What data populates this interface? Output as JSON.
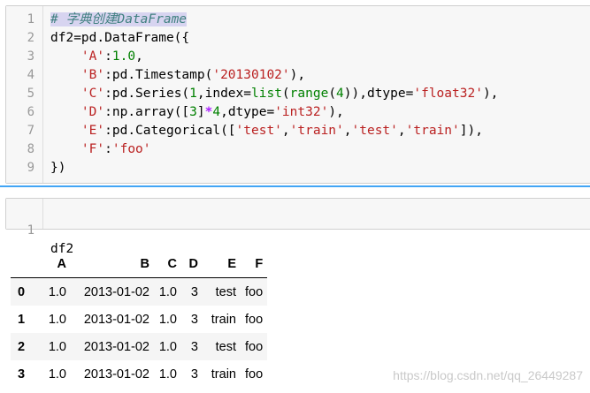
{
  "cell1": {
    "line_numbers": [
      "1",
      "2",
      "3",
      "4",
      "5",
      "6",
      "7",
      "8",
      "9"
    ],
    "lines": [
      [
        {
          "t": "# 字典创建DataFrame",
          "c": "cm"
        }
      ],
      [
        {
          "t": "df2=pd.DataFrame({",
          "c": ""
        }
      ],
      [
        {
          "t": "    ",
          "c": ""
        },
        {
          "t": "'A'",
          "c": "str"
        },
        {
          "t": ":",
          "c": ""
        },
        {
          "t": "1.0",
          "c": "num"
        },
        {
          "t": ",",
          "c": ""
        }
      ],
      [
        {
          "t": "    ",
          "c": ""
        },
        {
          "t": "'B'",
          "c": "str"
        },
        {
          "t": ":pd.Timestamp(",
          "c": ""
        },
        {
          "t": "'20130102'",
          "c": "str"
        },
        {
          "t": "),",
          "c": ""
        }
      ],
      [
        {
          "t": "    ",
          "c": ""
        },
        {
          "t": "'C'",
          "c": "str"
        },
        {
          "t": ":pd.Series(",
          "c": ""
        },
        {
          "t": "1",
          "c": "num"
        },
        {
          "t": ",index=",
          "c": ""
        },
        {
          "t": "list",
          "c": "kw"
        },
        {
          "t": "(",
          "c": ""
        },
        {
          "t": "range",
          "c": "kw"
        },
        {
          "t": "(",
          "c": ""
        },
        {
          "t": "4",
          "c": "num"
        },
        {
          "t": ")),dtype=",
          "c": ""
        },
        {
          "t": "'float32'",
          "c": "str"
        },
        {
          "t": "),",
          "c": ""
        }
      ],
      [
        {
          "t": "    ",
          "c": ""
        },
        {
          "t": "'D'",
          "c": "str"
        },
        {
          "t": ":np.array([",
          "c": ""
        },
        {
          "t": "3",
          "c": "num"
        },
        {
          "t": "]",
          "c": ""
        },
        {
          "t": "*",
          "c": "op"
        },
        {
          "t": "4",
          "c": "num"
        },
        {
          "t": ",dtype=",
          "c": ""
        },
        {
          "t": "'int32'",
          "c": "str"
        },
        {
          "t": "),",
          "c": ""
        }
      ],
      [
        {
          "t": "    ",
          "c": ""
        },
        {
          "t": "'E'",
          "c": "str"
        },
        {
          "t": ":pd.Categorical([",
          "c": ""
        },
        {
          "t": "'test'",
          "c": "str"
        },
        {
          "t": ",",
          "c": ""
        },
        {
          "t": "'train'",
          "c": "str"
        },
        {
          "t": ",",
          "c": ""
        },
        {
          "t": "'test'",
          "c": "str"
        },
        {
          "t": ",",
          "c": ""
        },
        {
          "t": "'train'",
          "c": "str"
        },
        {
          "t": "]),",
          "c": ""
        }
      ],
      [
        {
          "t": "    ",
          "c": ""
        },
        {
          "t": "'F'",
          "c": "str"
        },
        {
          "t": ":",
          "c": ""
        },
        {
          "t": "'foo'",
          "c": "str"
        }
      ],
      [
        {
          "t": "})",
          "c": ""
        }
      ]
    ]
  },
  "cell2": {
    "line_number": "1",
    "code": "df2"
  },
  "output": {
    "columns": [
      "",
      "A",
      "B",
      "C",
      "D",
      "E",
      "F"
    ],
    "rows": [
      [
        "0",
        "1.0",
        "2013-01-02",
        "1.0",
        "3",
        "test",
        "foo"
      ],
      [
        "1",
        "1.0",
        "2013-01-02",
        "1.0",
        "3",
        "train",
        "foo"
      ],
      [
        "2",
        "1.0",
        "2013-01-02",
        "1.0",
        "3",
        "test",
        "foo"
      ],
      [
        "3",
        "1.0",
        "2013-01-02",
        "1.0",
        "3",
        "train",
        "foo"
      ]
    ]
  },
  "watermark": "https://blog.csdn.net/qq_26449287",
  "colors": {
    "selection_bar": "#42a5f5",
    "string": "#ba2121",
    "keyword": "#008000",
    "comment": "#408080"
  }
}
